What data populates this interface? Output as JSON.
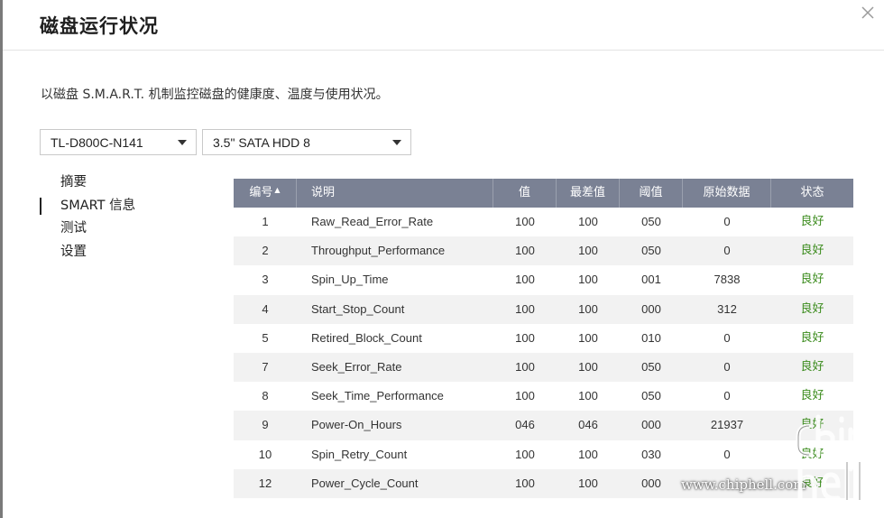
{
  "dialog": {
    "title": "磁盘运行状况",
    "description": "以磁盘 S.M.A.R.T. 机制监控磁盘的健康度、温度与使用状况。"
  },
  "selectors": {
    "enclosure": "TL-D800C-N141",
    "disk": "3.5\" SATA HDD 8"
  },
  "sidebar": {
    "items": [
      {
        "label": "摘要",
        "active": false
      },
      {
        "label": "SMART 信息",
        "active": true
      },
      {
        "label": "测试",
        "active": false
      },
      {
        "label": "设置",
        "active": false
      }
    ]
  },
  "table": {
    "headers": {
      "id": "编号",
      "name": "说明",
      "value": "值",
      "worst": "最差值",
      "threshold": "阈值",
      "raw": "原始数据",
      "status": "状态"
    },
    "rows": [
      {
        "id": "1",
        "name": "Raw_Read_Error_Rate",
        "value": "100",
        "worst": "100",
        "threshold": "050",
        "raw": "0",
        "status": "良好"
      },
      {
        "id": "2",
        "name": "Throughput_Performance",
        "value": "100",
        "worst": "100",
        "threshold": "050",
        "raw": "0",
        "status": "良好"
      },
      {
        "id": "3",
        "name": "Spin_Up_Time",
        "value": "100",
        "worst": "100",
        "threshold": "001",
        "raw": "7838",
        "status": "良好"
      },
      {
        "id": "4",
        "name": "Start_Stop_Count",
        "value": "100",
        "worst": "100",
        "threshold": "000",
        "raw": "312",
        "status": "良好"
      },
      {
        "id": "5",
        "name": "Retired_Block_Count",
        "value": "100",
        "worst": "100",
        "threshold": "010",
        "raw": "0",
        "status": "良好"
      },
      {
        "id": "7",
        "name": "Seek_Error_Rate",
        "value": "100",
        "worst": "100",
        "threshold": "050",
        "raw": "0",
        "status": "良好"
      },
      {
        "id": "8",
        "name": "Seek_Time_Performance",
        "value": "100",
        "worst": "100",
        "threshold": "050",
        "raw": "0",
        "status": "良好"
      },
      {
        "id": "9",
        "name": "Power-On_Hours",
        "value": "046",
        "worst": "046",
        "threshold": "000",
        "raw": "21937",
        "status": "良好"
      },
      {
        "id": "10",
        "name": "Spin_Retry_Count",
        "value": "100",
        "worst": "100",
        "threshold": "030",
        "raw": "0",
        "status": "良好"
      },
      {
        "id": "12",
        "name": "Power_Cycle_Count",
        "value": "100",
        "worst": "100",
        "threshold": "000",
        "raw": "",
        "status": "良好"
      }
    ]
  },
  "watermark": {
    "site": "www.chiphell.com",
    "logo_text": "chip hell"
  },
  "colors": {
    "header_bg": "#7a8194",
    "status_good": "#3c8c1e",
    "row_alt": "#f2f2f2"
  }
}
